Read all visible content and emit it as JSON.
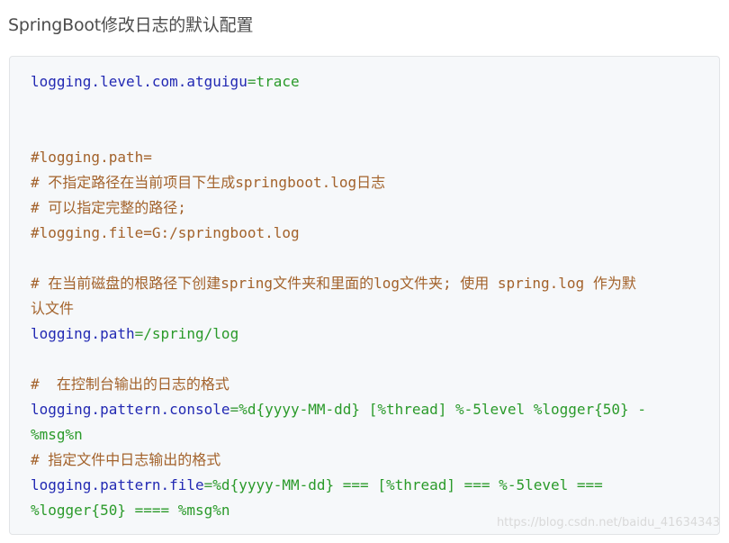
{
  "title": "SpringBoot修改日志的默认配置",
  "code": {
    "l1_key": "logging.level.com.atguigu",
    "l1_eq": "=",
    "l1_val": "trace",
    "c1": "#logging.path=",
    "c2": "# 不指定路径在当前项目下生成springboot.log日志",
    "c3": "# 可以指定完整的路径;",
    "c4": "#logging.file=G:/springboot.log",
    "c5a": "# 在当前磁盘的根路径下创建spring文件夹和里面的log文件夹; 使用 spring.log 作为默",
    "c5b": "认文件",
    "l2_key": "logging.path",
    "l2_eq": "=",
    "l2_val": "/spring/log",
    "c6": "#  在控制台输出的日志的格式",
    "l3_key": "logging.pattern.console",
    "l3_eq": "=",
    "l3_val_a": "%d{yyyy-MM-dd} [%thread] %-5level %logger{50} -",
    "l3_val_b": "%msg%n",
    "c7": "# 指定文件中日志输出的格式",
    "l4_key": "logging.pattern.file",
    "l4_eq": "=",
    "l4_val_a": "%d{yyyy-MM-dd} === [%thread] === %-5level ===",
    "l4_val_b": "%logger{50} ==== %msg%n"
  },
  "watermark": "https://blog.csdn.net/baidu_41634343"
}
